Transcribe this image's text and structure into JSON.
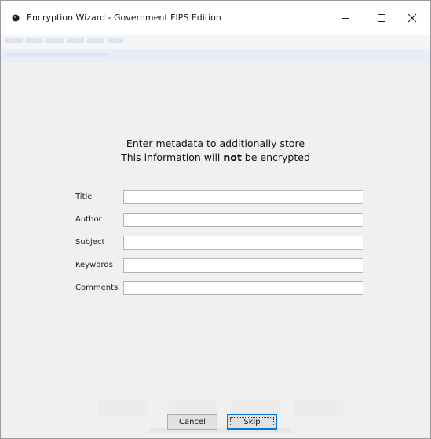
{
  "window": {
    "title": "Encryption Wizard - Government FIPS Edition",
    "icon": "app-icon",
    "controls": {
      "minimize_icon": "minimize-icon",
      "maximize_icon": "maximize-icon",
      "close_icon": "close-icon"
    }
  },
  "dialog": {
    "heading_line1": "Enter metadata to additionally store",
    "heading_line2_prefix": "This information will ",
    "heading_line2_bold": "not",
    "heading_line2_suffix": " be encrypted",
    "fields": [
      {
        "label": "Title",
        "value": "",
        "placeholder": ""
      },
      {
        "label": "Author",
        "value": "",
        "placeholder": ""
      },
      {
        "label": "Subject",
        "value": "",
        "placeholder": ""
      },
      {
        "label": "Keywords",
        "value": "",
        "placeholder": ""
      },
      {
        "label": "Comments",
        "value": "",
        "placeholder": ""
      }
    ],
    "buttons": {
      "cancel": "Cancel",
      "skip": "Skip"
    }
  },
  "colors": {
    "window_bg": "#f0f0f0",
    "titlebar_bg": "#ffffff",
    "focus_accent": "#0078d7"
  }
}
